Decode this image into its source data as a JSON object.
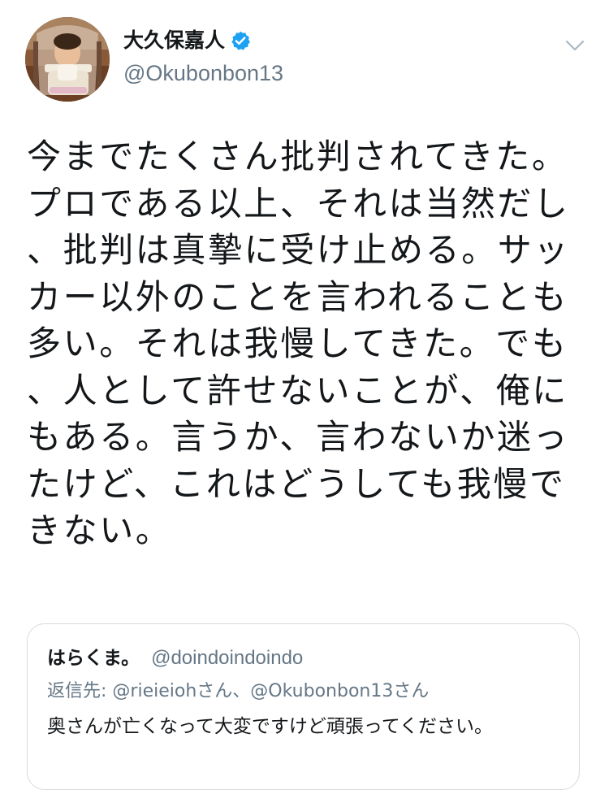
{
  "tweet": {
    "author": {
      "display_name": "大久保嘉人",
      "handle": "@Okubonbon13",
      "verified": true
    },
    "text": "今までたくさん批判されてきた。プロである以上、それは当然だし、批判は真摯に受け止める。サッカー以外のことを言われることも多い。それは我慢してきた。でも、人として許せないことが、俺にもある。言うか、言わないか迷ったけど、これはどうしても我慢できない。"
  },
  "quoted_tweet": {
    "display_name": "はらくま。",
    "handle": "@doindoindoindo",
    "reply_prefix": "返信先: ",
    "reply_to_1": "@rieieioh",
    "reply_to_1_suffix": "さん、",
    "reply_to_2": "@Okubonbon13",
    "reply_to_2_suffix": "さん",
    "text": "奥さんが亡くなって大変ですけど頑張ってください。"
  },
  "colors": {
    "text_primary": "#14171a",
    "text_secondary": "#657786",
    "verified_blue": "#1da1f2",
    "card_border": "#d5dbe0"
  },
  "icons": {
    "verified": "verified-badge-icon",
    "menu": "chevron-down-icon"
  }
}
